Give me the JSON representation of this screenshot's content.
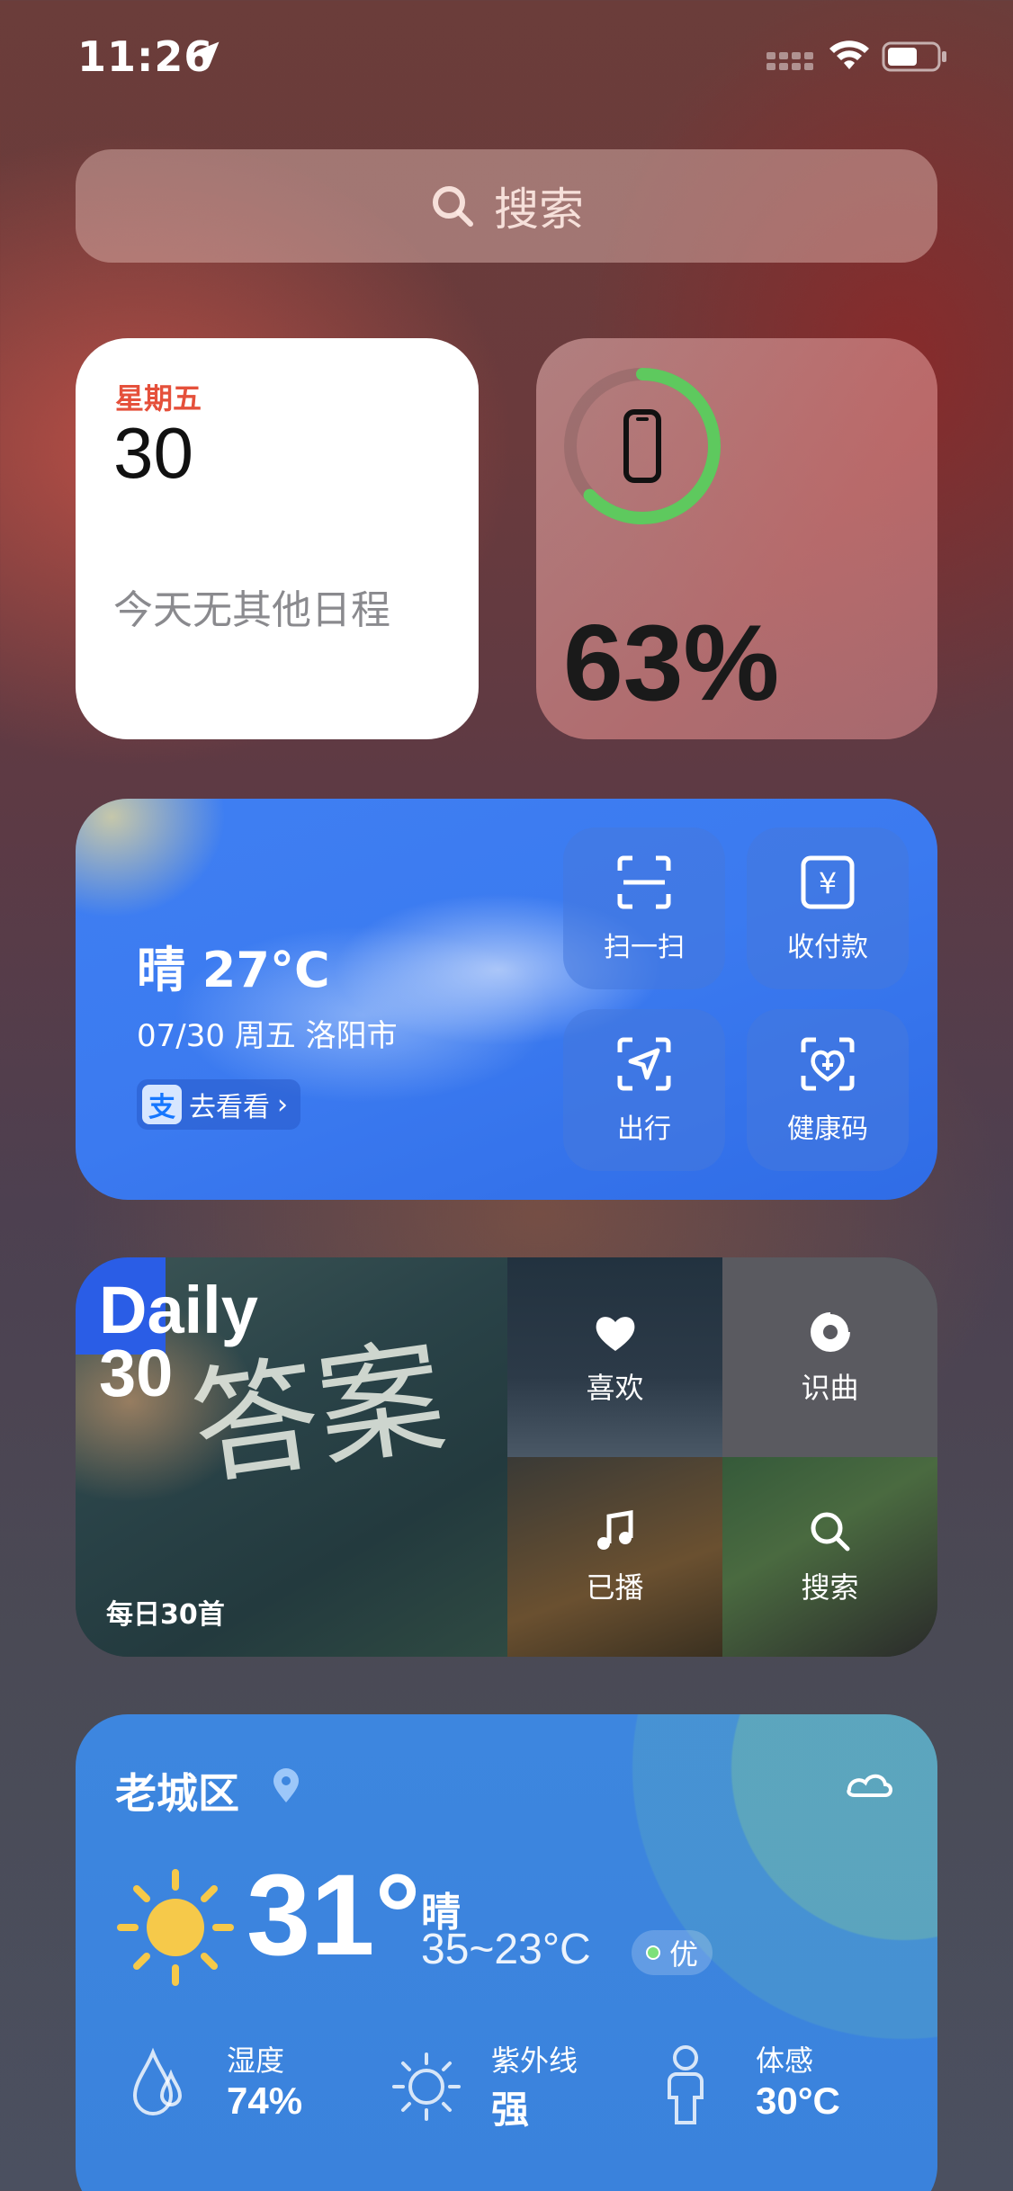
{
  "status_bar": {
    "time": "11:26"
  },
  "search": {
    "placeholder": "搜索"
  },
  "calendar": {
    "weekday": "星期五",
    "day": "30",
    "empty_text": "今天无其他日程"
  },
  "battery_widget": {
    "percent_label": "63%",
    "percent": 63,
    "ring_color": "#5ec95e"
  },
  "alipay": {
    "weather": "晴 27°C",
    "date_location": "07/30 周五 洛阳市",
    "logo": "支",
    "go_label": "去看看",
    "tiles": [
      {
        "label": "扫一扫",
        "icon": "scan-icon"
      },
      {
        "label": "收付款",
        "icon": "yuan-icon"
      },
      {
        "label": "出行",
        "icon": "navigation-icon"
      },
      {
        "label": "健康码",
        "icon": "health-code-icon"
      }
    ]
  },
  "music": {
    "badge_line1": "Daily",
    "badge_line2": "30",
    "cover_art": "答案",
    "subtitle": "每日30首",
    "tiles": [
      {
        "label": "喜欢",
        "icon": "heart-icon"
      },
      {
        "label": "识曲",
        "icon": "music-recognition-icon"
      },
      {
        "label": "已播",
        "icon": "music-note-icon"
      },
      {
        "label": "搜索",
        "icon": "search-icon"
      }
    ]
  },
  "weather": {
    "city": "老城区",
    "temp": "31°",
    "condition": "晴",
    "range": "35~23°C",
    "aqi": "优",
    "stats": [
      {
        "label": "湿度",
        "value": "74%",
        "icon": "humidity-icon"
      },
      {
        "label": "紫外线",
        "value": "强",
        "icon": "uv-icon"
      },
      {
        "label": "体感",
        "value": "30°C",
        "icon": "person-icon"
      }
    ]
  }
}
